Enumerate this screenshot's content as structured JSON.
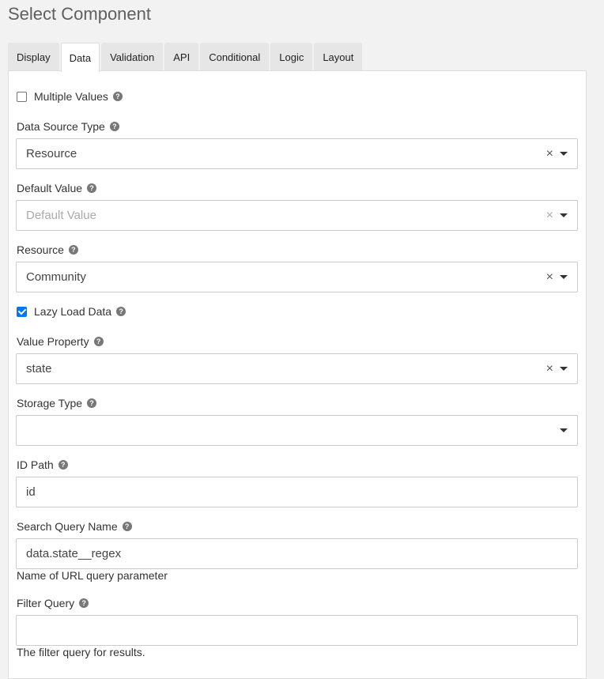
{
  "page": {
    "title": "Select Component"
  },
  "tabs": [
    {
      "label": "Display"
    },
    {
      "label": "Data"
    },
    {
      "label": "Validation"
    },
    {
      "label": "API"
    },
    {
      "label": "Conditional"
    },
    {
      "label": "Logic"
    },
    {
      "label": "Layout"
    }
  ],
  "form": {
    "multiple_values": {
      "label": "Multiple Values",
      "checked": false
    },
    "data_source_type": {
      "label": "Data Source Type",
      "value": "Resource"
    },
    "default_value": {
      "label": "Default Value",
      "placeholder": "Default Value"
    },
    "resource": {
      "label": "Resource",
      "value": "Community"
    },
    "lazy_load": {
      "label": "Lazy Load Data",
      "checked": true
    },
    "value_property": {
      "label": "Value Property",
      "value": "state"
    },
    "storage_type": {
      "label": "Storage Type",
      "value": ""
    },
    "id_path": {
      "label": "ID Path",
      "value": "id"
    },
    "search_query_name": {
      "label": "Search Query Name",
      "value": "data.state__regex",
      "hint": "Name of URL query parameter"
    },
    "filter_query": {
      "label": "Filter Query",
      "value": "",
      "hint": "The filter query for results."
    }
  },
  "icons": {
    "help": "question-circle-icon",
    "clear": "close-icon",
    "caret": "caret-down-icon"
  },
  "glyphs": {
    "help": "?",
    "clear": "×"
  }
}
